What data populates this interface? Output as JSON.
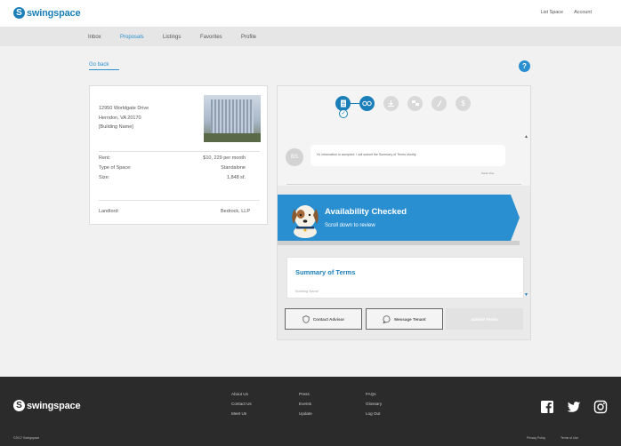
{
  "brand": {
    "name": "swingspace"
  },
  "header": {
    "links": [
      "List Space",
      "Account"
    ]
  },
  "nav": {
    "tabs": [
      "Inbox",
      "Proposals",
      "Listings",
      "Favorites",
      "Profile"
    ],
    "active": "Proposals"
  },
  "page": {
    "go_back": "Go back",
    "help": "?"
  },
  "property": {
    "street": "12950 Worldgate Drive",
    "city": "Herndon, VA 20170",
    "building": "[Building Name]",
    "details": [
      {
        "label": "Rent:",
        "value": "$10, 229 per month"
      },
      {
        "label": "Type of Space:",
        "value": "Standalone"
      },
      {
        "label": "Size:",
        "value": "1,848 sf."
      }
    ],
    "landlord_label": "Landlord:",
    "landlord_value": "Bedrock, LLP"
  },
  "proposal": {
    "steps": [
      "document-icon",
      "handshake-icon",
      "download-icon",
      "negotiate-icon",
      "sign-icon",
      "payment-icon"
    ],
    "active_steps": 2,
    "message": {
      "initials": "BS",
      "text": "Hi, information is accepted. I will submit the Summary of Terms shortly.",
      "time": "Sarah Doe"
    },
    "banner": {
      "title": "Availability Checked",
      "subtitle": "Scroll down to review"
    },
    "summary": {
      "title": "Summary of Terms",
      "subtitle": "Building Name"
    },
    "buttons": {
      "contact_advisor": "Contact Advisor",
      "message_tenant": "Message Tenant",
      "submit": "Submit Terms"
    }
  },
  "footer": {
    "col1": [
      "About Us",
      "Contact Us",
      "Meet Us"
    ],
    "col2": [
      "Press",
      "Events",
      "Update"
    ],
    "col3": [
      "FAQs",
      "Glossary",
      "Log Out"
    ],
    "copyright": "©2017 Swingspace",
    "legal": [
      "Privacy Policy",
      "Terms of Use"
    ],
    "social": [
      "facebook-icon",
      "twitter-icon",
      "instagram-icon"
    ]
  },
  "colors": {
    "brand": "#1a7fb8",
    "accent": "#2a8fd0",
    "footer_bg": "#2b2b2b"
  }
}
